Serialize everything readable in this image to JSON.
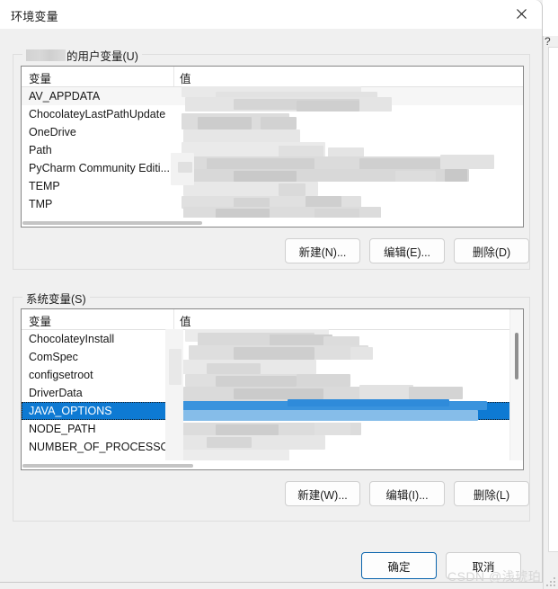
{
  "window": {
    "title": "环境变量",
    "close_icon": "close-icon",
    "background_window_help_icon": "help-icon"
  },
  "user_section": {
    "legend_masked_user": "",
    "legend_suffix": "的用户变量(U)",
    "legend_accesskey": "U",
    "columns": {
      "variable": "变量",
      "value": "值"
    },
    "rows": [
      {
        "name": "AV_APPDATA",
        "value": "",
        "redacted": true
      },
      {
        "name": "ChocolateyLastPathUpdate",
        "value": "",
        "redacted": true
      },
      {
        "name": "OneDrive",
        "value": "",
        "redacted": true
      },
      {
        "name": "Path",
        "value": "",
        "redacted": true
      },
      {
        "name": "PyCharm Community Editi...",
        "value": "",
        "redacted": true
      },
      {
        "name": "TEMP",
        "value": "",
        "redacted": true
      },
      {
        "name": "TMP",
        "value": "",
        "redacted": true
      }
    ],
    "buttons": {
      "new": "新建(N)...",
      "edit": "编辑(E)...",
      "delete": "删除(D)"
    }
  },
  "system_section": {
    "legend": "系统变量(S)",
    "legend_accesskey": "S",
    "columns": {
      "variable": "变量",
      "value": "值"
    },
    "rows": [
      {
        "name": "ChocolateyInstall",
        "value": "",
        "redacted": true,
        "selected": false
      },
      {
        "name": "ComSpec",
        "value": "",
        "redacted": true,
        "selected": false
      },
      {
        "name": "configsetroot",
        "value": "",
        "redacted": true,
        "selected": false
      },
      {
        "name": "DriverData",
        "value": "",
        "redacted": true,
        "selected": false
      },
      {
        "name": "JAVA_OPTIONS",
        "value": "",
        "redacted": true,
        "selected": true
      },
      {
        "name": "NODE_PATH",
        "value": "",
        "redacted": true,
        "selected": false
      },
      {
        "name": "NUMBER_OF_PROCESSORS",
        "value": "",
        "redacted": true,
        "selected": false
      }
    ],
    "buttons": {
      "new": "新建(W)...",
      "edit": "编辑(I)...",
      "delete": "删除(L)"
    }
  },
  "footer": {
    "ok": "确定",
    "cancel": "取消"
  },
  "watermark": "CSDN @浅琥珀",
  "colors": {
    "selection_blue": "#0e7ad3",
    "default_button_border": "#0a64ad",
    "dialog_background": "#f0f0f0",
    "list_background": "#ffffff"
  }
}
